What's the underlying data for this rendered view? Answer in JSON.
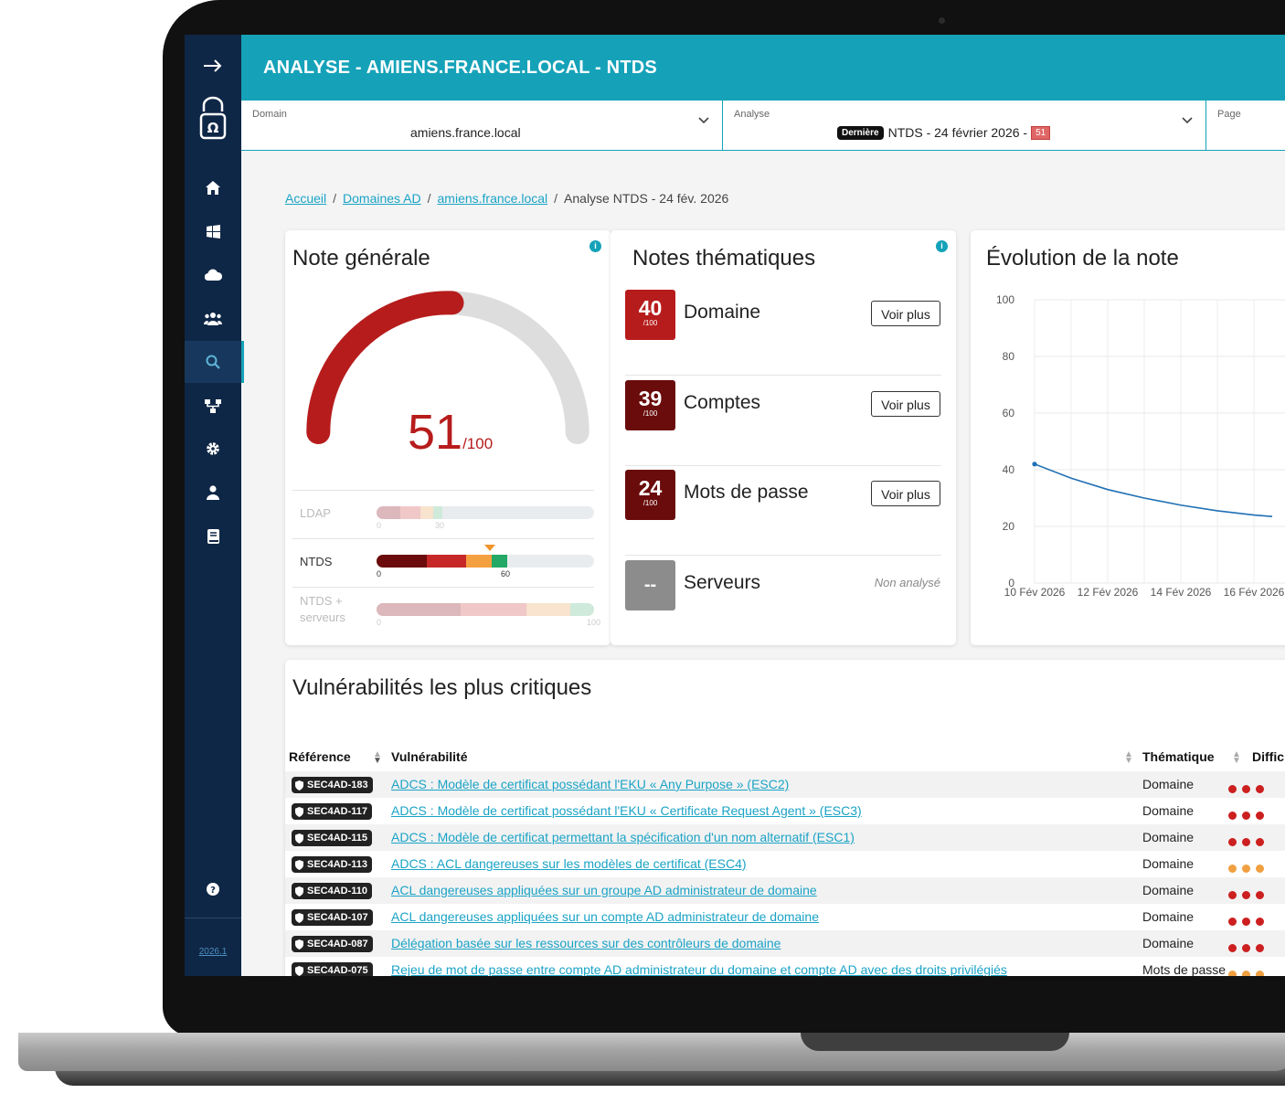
{
  "header": {
    "title": "ANALYSE - AMIENS.FRANCE.LOCAL - NTDS"
  },
  "sidebar": {
    "items": [
      {
        "icon": "arrow-right-icon"
      },
      {
        "icon": "lock-logo-icon"
      },
      {
        "icon": "home-icon"
      },
      {
        "icon": "windows-icon"
      },
      {
        "icon": "cloud-icon"
      },
      {
        "icon": "users-icon"
      },
      {
        "icon": "search-icon",
        "active": true
      },
      {
        "icon": "network-icon"
      },
      {
        "icon": "gear-icon"
      },
      {
        "icon": "user-icon"
      },
      {
        "icon": "book-icon"
      },
      {
        "icon": "help-icon"
      }
    ],
    "version": "2026.1"
  },
  "filters": {
    "domain": {
      "label": "Domain",
      "value": "amiens.france.local"
    },
    "analyse": {
      "label": "Analyse",
      "badge": "Dernière",
      "value": "NTDS - 24 février 2026 -",
      "score": "51"
    },
    "page": {
      "label": "Page"
    }
  },
  "breadcrumb": {
    "items": [
      "Accueil",
      "Domaines AD",
      "amiens.france.local"
    ],
    "current": "Analyse NTDS - 24 fév. 2026"
  },
  "general": {
    "title": "Note générale",
    "score": "51",
    "score_max": "/100",
    "gauge_fraction": 0.51,
    "colors": {
      "gauge": "#b71c1c",
      "track": "#dddddd"
    },
    "rows": [
      {
        "label": "LDAP",
        "min": "0",
        "mark": "30",
        "faded": true
      },
      {
        "label": "NTDS",
        "min": "0",
        "mark": "60",
        "faded": false
      },
      {
        "label": "NTDS + serveurs",
        "min": "0",
        "mark": "100",
        "faded": true
      }
    ]
  },
  "themes": {
    "title": "Notes thématiques",
    "items": [
      {
        "score": "40",
        "out": "/100",
        "name": "Domaine",
        "action": "Voir plus",
        "color": "#b71c1c"
      },
      {
        "score": "39",
        "out": "/100",
        "name": "Comptes",
        "action": "Voir plus",
        "color": "#6a0c0c"
      },
      {
        "score": "24",
        "out": "/100",
        "name": "Mots de passe",
        "action": "Voir plus",
        "color": "#6a0c0c"
      },
      {
        "score": "--",
        "name": "Serveurs",
        "status": "Non analysé",
        "color": "#8c8c8c"
      }
    ]
  },
  "chart_data": {
    "type": "line",
    "title": "Évolution de la note",
    "x": [
      "10 Fév 2026",
      "12 Fév 2026",
      "14 Fév 2026",
      "16 Fév 2026"
    ],
    "y_ticks": [
      "100",
      "80",
      "60",
      "40",
      "20",
      "0"
    ],
    "ylim": [
      0,
      100
    ],
    "series": [
      {
        "points": [
          {
            "x": "10 Fév 2026",
            "y": 42
          },
          {
            "x": "11 Fév 2026",
            "y": 37
          },
          {
            "x": "12 Fév 2026",
            "y": 33
          },
          {
            "x": "13 Fév 2026",
            "y": 30
          },
          {
            "x": "14 Fév 2026",
            "y": 27.5
          },
          {
            "x": "15 Fév 2026",
            "y": 25.5
          },
          {
            "x": "16 Fév 2026",
            "y": 24
          },
          {
            "x": "16.5 Fév 2026",
            "y": 23.5
          }
        ]
      }
    ],
    "grid": true,
    "color": "#1f6fb4"
  },
  "vulns": {
    "title": "Vulnérabilités les plus critiques",
    "columns": [
      "Référence",
      "Vulnérabilité",
      "Thématique",
      "Diffic"
    ],
    "colors": {
      "red": "#cc1f1f",
      "orange": "#f0a040"
    },
    "rows": [
      {
        "ref": "SEC4AD-183",
        "label": "ADCS : Modèle de certificat possédant l'EKU « Any Purpose » (ESC2)",
        "theme": "Domaine",
        "dots": [
          "red",
          "red",
          "red"
        ]
      },
      {
        "ref": "SEC4AD-117",
        "label": "ADCS : Modèle de certificat possédant l'EKU « Certificate Request Agent » (ESC3)",
        "theme": "Domaine",
        "dots": [
          "red",
          "red",
          "red"
        ]
      },
      {
        "ref": "SEC4AD-115",
        "label": "ADCS : Modèle de certificat permettant la spécification d'un nom alternatif (ESC1)",
        "theme": "Domaine",
        "dots": [
          "red",
          "red",
          "red"
        ]
      },
      {
        "ref": "SEC4AD-113",
        "label": "ADCS : ACL dangereuses sur les modèles de certificat (ESC4)",
        "theme": "Domaine",
        "dots": [
          "orange",
          "orange",
          "orange"
        ]
      },
      {
        "ref": "SEC4AD-110",
        "label": "ACL dangereuses appliquées sur un groupe AD administrateur de domaine",
        "theme": "Domaine",
        "dots": [
          "red",
          "red",
          "red"
        ]
      },
      {
        "ref": "SEC4AD-107",
        "label": "ACL dangereuses appliquées sur un compte AD administrateur de domaine",
        "theme": "Domaine",
        "dots": [
          "red",
          "red",
          "red"
        ]
      },
      {
        "ref": "SEC4AD-087",
        "label": "Délégation basée sur les ressources sur des contrôleurs de domaine",
        "theme": "Domaine",
        "dots": [
          "red",
          "red",
          "red"
        ]
      },
      {
        "ref": "SEC4AD-075",
        "label": "Rejeu de mot de passe entre compte AD administrateur du domaine et compte AD avec des droits privilégiés",
        "theme": "Mots de passe",
        "dots": [
          "orange",
          "orange",
          "orange"
        ]
      }
    ]
  }
}
